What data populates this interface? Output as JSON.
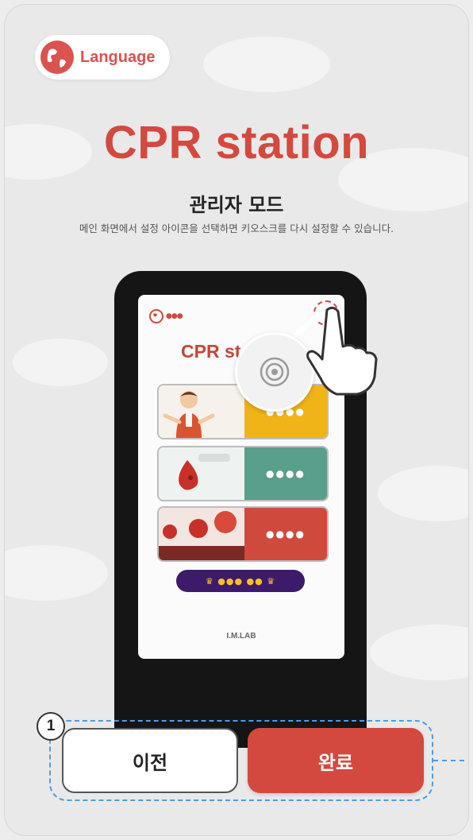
{
  "language": {
    "label": "Language",
    "icon": "globe-icon"
  },
  "header": {
    "title": "CPR station",
    "subtitle": "관리자 모드",
    "description": "메인 화면에서 설정 아이콘을 선택하면 키오스크를 다시 설정할 수 있습니다."
  },
  "kiosk": {
    "logo_dots": "●●●",
    "title": "CPR st",
    "cards": [
      {
        "label": "●●●●",
        "color": "#f0b318"
      },
      {
        "label": "●●●●",
        "color": "#5a9e8c"
      },
      {
        "label": "●●●●",
        "color": "#cf4a3c"
      }
    ],
    "ranking_label": "♛ ●●● ●● ♛",
    "brand": "I.M.LAB"
  },
  "step": {
    "number": "1"
  },
  "actions": {
    "prev_label": "이전",
    "done_label": "완료"
  },
  "colors": {
    "accent": "#d4493f",
    "highlight": "#4b9ce7",
    "ranking": "#3e1a6a"
  }
}
